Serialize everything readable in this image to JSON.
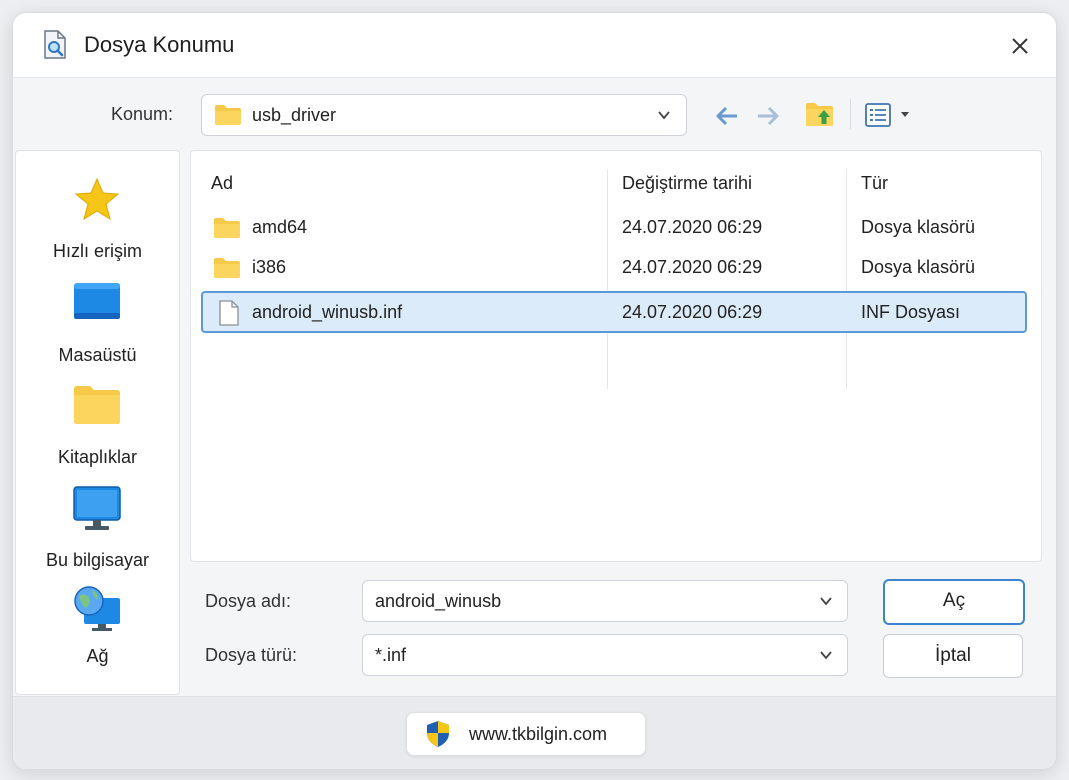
{
  "window": {
    "title": "Dosya Konumu",
    "title_icon": "file-search-icon",
    "close_icon": "close-icon"
  },
  "location": {
    "label": "Konum:",
    "value": "usb_driver",
    "icon": "folder-icon"
  },
  "toolbar": {
    "back_icon": "arrow-left-icon",
    "forward_icon": "arrow-right-icon",
    "up_icon": "folder-up-icon",
    "view_icon": "view-details-icon"
  },
  "sidebar": {
    "items": [
      {
        "label": "Hızlı erişim",
        "icon": "star-icon"
      },
      {
        "label": "Masaüstü",
        "icon": "desktop-icon"
      },
      {
        "label": "Kitaplıklar",
        "icon": "folder-icon"
      },
      {
        "label": "Bu bilgisayar",
        "icon": "computer-icon"
      },
      {
        "label": "Ağ",
        "icon": "network-icon"
      }
    ]
  },
  "filelist": {
    "columns": [
      "Ad",
      "Değiştirme tarihi",
      "Tür"
    ],
    "rows": [
      {
        "name": "amd64",
        "date": "24.07.2020 06:29",
        "type": "Dosya klasörü",
        "icon": "folder-icon",
        "selected": false
      },
      {
        "name": "i386",
        "date": "24.07.2020 06:29",
        "type": "Dosya klasörü",
        "icon": "folder-icon",
        "selected": false
      },
      {
        "name": "android_winusb.inf",
        "date": "24.07.2020 06:29",
        "type": "INF Dosyası",
        "icon": "file-icon",
        "selected": true
      }
    ]
  },
  "filename": {
    "label": "Dosya adı:",
    "value": "android_winusb"
  },
  "filetype": {
    "label": "Dosya türü:",
    "value": "*.inf"
  },
  "buttons": {
    "open": "Aç",
    "cancel": "İptal"
  },
  "footer": {
    "site": "www.tkbilgin.com",
    "icon": "shield-icon"
  },
  "colors": {
    "accent": "#3d84cf",
    "selection": "#dcebf9",
    "folder": "#f7c948"
  }
}
